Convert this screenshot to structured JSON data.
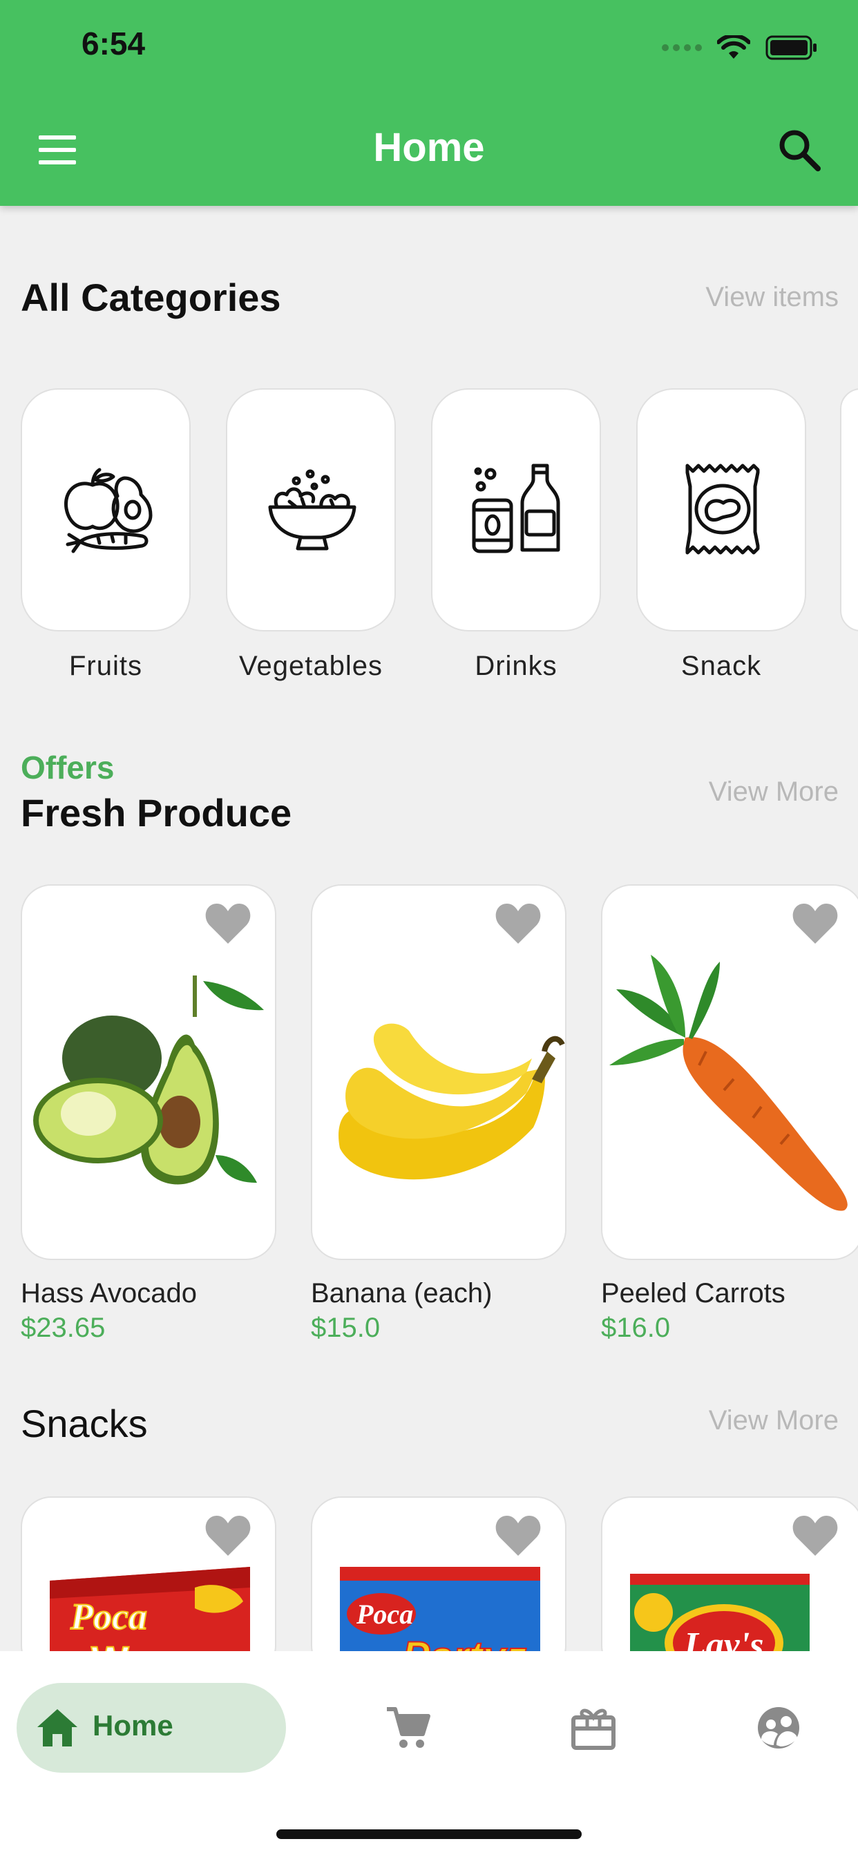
{
  "status": {
    "time": "6:54"
  },
  "appbar": {
    "title": "Home",
    "menu_icon": "menu-icon",
    "search_icon": "search-icon"
  },
  "categories": {
    "title": "All Categories",
    "link": "View items",
    "items": [
      {
        "label": "Fruits",
        "icon": "fruits-icon"
      },
      {
        "label": "Vegetables",
        "icon": "salad-bowl-icon"
      },
      {
        "label": "Drinks",
        "icon": "drinks-icon"
      },
      {
        "label": "Snack",
        "icon": "snack-bag-icon"
      }
    ]
  },
  "offers": {
    "eyebrow": "Offers",
    "title": "Fresh Produce",
    "link": "View More",
    "products": [
      {
        "name": "Hass Avocado",
        "price": "$23.65"
      },
      {
        "name": "Banana (each)",
        "price": "$15.0"
      },
      {
        "name": "Peeled Carrots",
        "price": "$16.0"
      }
    ]
  },
  "snacks": {
    "title": "Snacks",
    "link": "View More",
    "products": [
      {
        "brand": "Poca",
        "name": "Wavy"
      },
      {
        "brand": "Poca",
        "name": "Partyz"
      },
      {
        "brand": "Lay's",
        "name": ""
      }
    ]
  },
  "bottom_nav": {
    "items": [
      {
        "label": "Home",
        "icon": "home-icon",
        "active": true
      },
      {
        "label": "",
        "icon": "cart-icon"
      },
      {
        "label": "",
        "icon": "gift-icon"
      },
      {
        "label": "",
        "icon": "profile-icon"
      }
    ]
  },
  "colors": {
    "primary": "#47c160",
    "price": "#4cae5a",
    "nav_active_bg": "#d7e9d9",
    "nav_active_fg": "#2c7b35"
  }
}
